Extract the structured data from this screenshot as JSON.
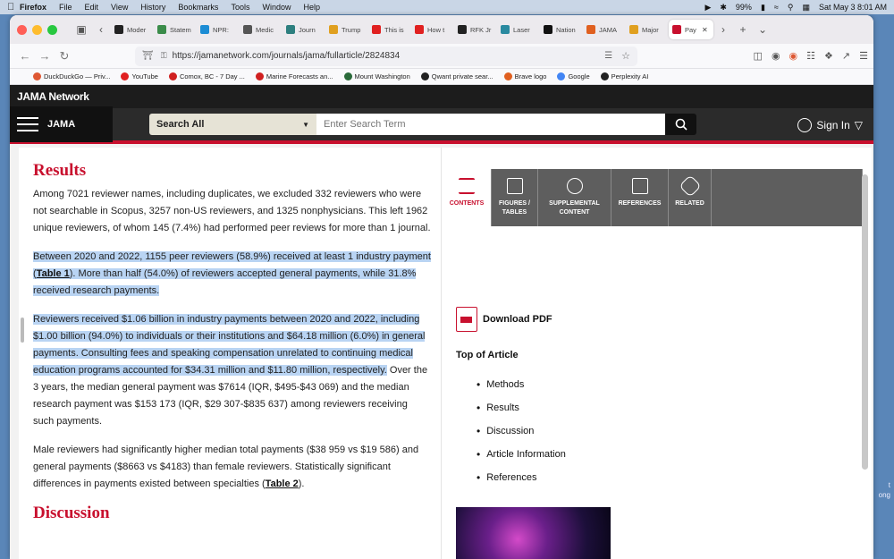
{
  "menubar": {
    "app": "Firefox",
    "items": [
      "File",
      "Edit",
      "View",
      "History",
      "Bookmarks",
      "Tools",
      "Window",
      "Help"
    ],
    "battery": "99%",
    "datetime": "Sat May 3  8:01 AM"
  },
  "tabs": [
    {
      "label": "Moder",
      "color": "#222"
    },
    {
      "label": "Statem",
      "color": "#3b8c4a"
    },
    {
      "label": "NPR:",
      "color": "#1c8cd4"
    },
    {
      "label": "Medic",
      "color": "#555"
    },
    {
      "label": "Journ",
      "color": "#2d7f7f"
    },
    {
      "label": "Trump",
      "color": "#e0a020"
    },
    {
      "label": "This is",
      "color": "#e02020"
    },
    {
      "label": "How t",
      "color": "#e02020"
    },
    {
      "label": "RFK Jr",
      "color": "#222"
    },
    {
      "label": "Laser",
      "color": "#2a8aa0"
    },
    {
      "label": "Nation",
      "color": "#111"
    },
    {
      "label": "JAMA",
      "color": "#e06020"
    },
    {
      "label": "Major",
      "color": "#e0a020"
    },
    {
      "label": "Pay",
      "color": "#c8102e",
      "active": true
    }
  ],
  "url": "https://jamanetwork.com/journals/jama/fullarticle/2824834",
  "bookmarks": [
    {
      "label": "DuckDuckGo — Priv...",
      "color": "#de5833"
    },
    {
      "label": "YouTube",
      "color": "#e02020"
    },
    {
      "label": "Comox, BC - 7 Day ...",
      "color": "#d02020"
    },
    {
      "label": "Marine Forecasts an...",
      "color": "#d02020"
    },
    {
      "label": "Mount Washington",
      "color": "#2a6a3a"
    },
    {
      "label": "Qwant  private sear...",
      "color": "#222"
    },
    {
      "label": "Brave logo",
      "color": "#e06020"
    },
    {
      "label": "Google",
      "color": "#4285f4"
    },
    {
      "label": "Perplexity AI",
      "color": "#222"
    }
  ],
  "site": {
    "network_title": "JAMA Network",
    "logo": "JAMA",
    "search_scope": "Search All",
    "search_placeholder": "Enter Search Term",
    "sign_in": "Sign In"
  },
  "article": {
    "results_heading": "Results",
    "p1": "Among 7021 reviewer names, including duplicates, we excluded 332 reviewers who were not searchable in Scopus, 3257 non-US reviewers, and 1325 nonphysicians. This left 1962 unique reviewers, of whom 145 (7.4%) had performed peer reviews for more than 1 journal.",
    "p2a": "Between 2020 and 2022, 1155 peer reviewers (58.9%) received at least 1 industry payment (",
    "p2link": "Table 1",
    "p2b": "). More than half (54.0%) of reviewers accepted general payments, while 31.8% received research payments.",
    "p3a": "Reviewers received $1.06 billion in industry payments between 2020 and 2022, including $1.00 billion (94.0%) to individuals or their institutions and $64.18 million (6.0%) in general payments. Consulting fees and speaking compensation unrelated to continuing medical education programs accounted for $34.31 million and $11.80 million, respectively.",
    "p3b": " Over the 3 years, the median general payment was $7614 (IQR, $495-$43 069) and the median research payment was $153 173 (IQR, $29 307-$835 637) among reviewers receiving such payments.",
    "p4a": "Male reviewers had significantly higher median total payments ($38 959 vs $19 586) and general payments ($8663 vs $4183) than female reviewers. Statistically significant differences in payments existed between specialties (",
    "p4link": "Table 2",
    "p4b": ").",
    "discussion_heading": "Discussion"
  },
  "sidebar": {
    "tabs": [
      "CONTENTS",
      "FIGURES / TABLES",
      "SUPPLEMENTAL CONTENT",
      "REFERENCES",
      "RELATED"
    ],
    "download_pdf": "Download PDF",
    "toc_title": "Top of Article",
    "toc": [
      "Methods",
      "Results",
      "Discussion",
      "Article Information",
      "References"
    ]
  },
  "desktop": {
    "side_text_1": "t",
    "side_text_2": "ong"
  }
}
